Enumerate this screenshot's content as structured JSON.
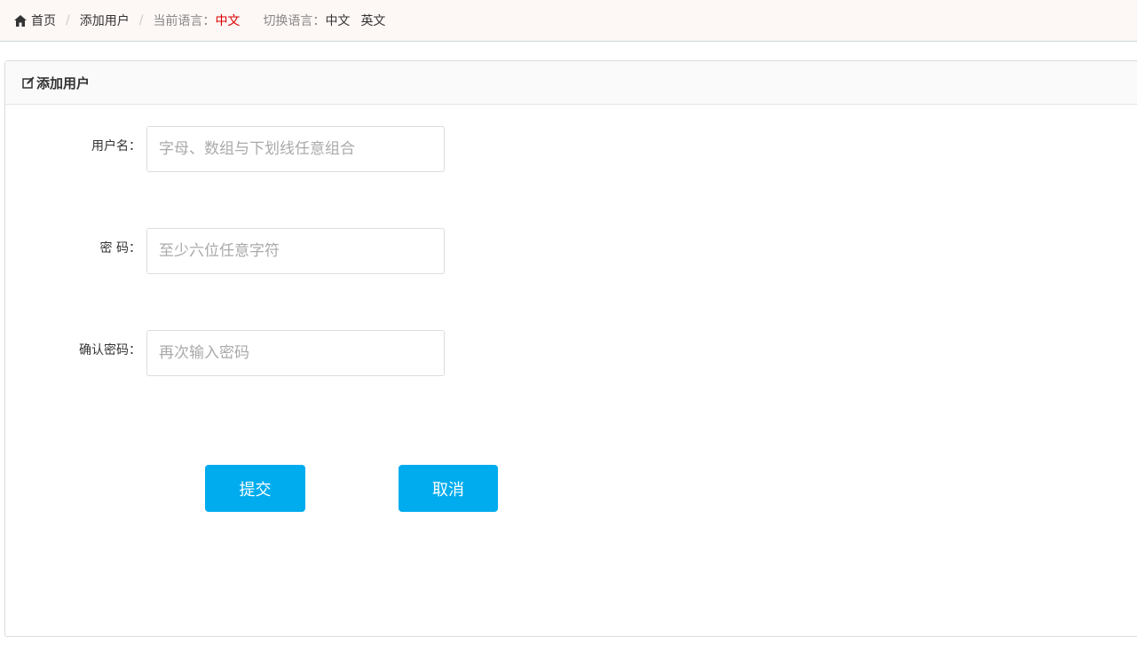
{
  "breadcrumb": {
    "home": "首页",
    "add_user": "添加用户",
    "current_lang_label": "当前语言：",
    "current_lang_value": "中文",
    "switch_lang_label": "切换语言：",
    "lang_options": [
      "中文",
      "英文"
    ]
  },
  "panel": {
    "title": "添加用户"
  },
  "form": {
    "username": {
      "label": "用户名：",
      "placeholder": "字母、数组与下划线任意组合",
      "value": ""
    },
    "password": {
      "label": "密 码：",
      "placeholder": "至少六位任意字符",
      "value": ""
    },
    "confirm_password": {
      "label": "确认密码：",
      "placeholder": "再次输入密码",
      "value": ""
    }
  },
  "buttons": {
    "submit": "提交",
    "cancel": "取消"
  },
  "colors": {
    "accent": "#00aced",
    "current_lang": "#d80000",
    "topbar_bg": "#fdf7f5"
  },
  "icons": {
    "home": "home-icon",
    "edit": "edit-icon"
  }
}
